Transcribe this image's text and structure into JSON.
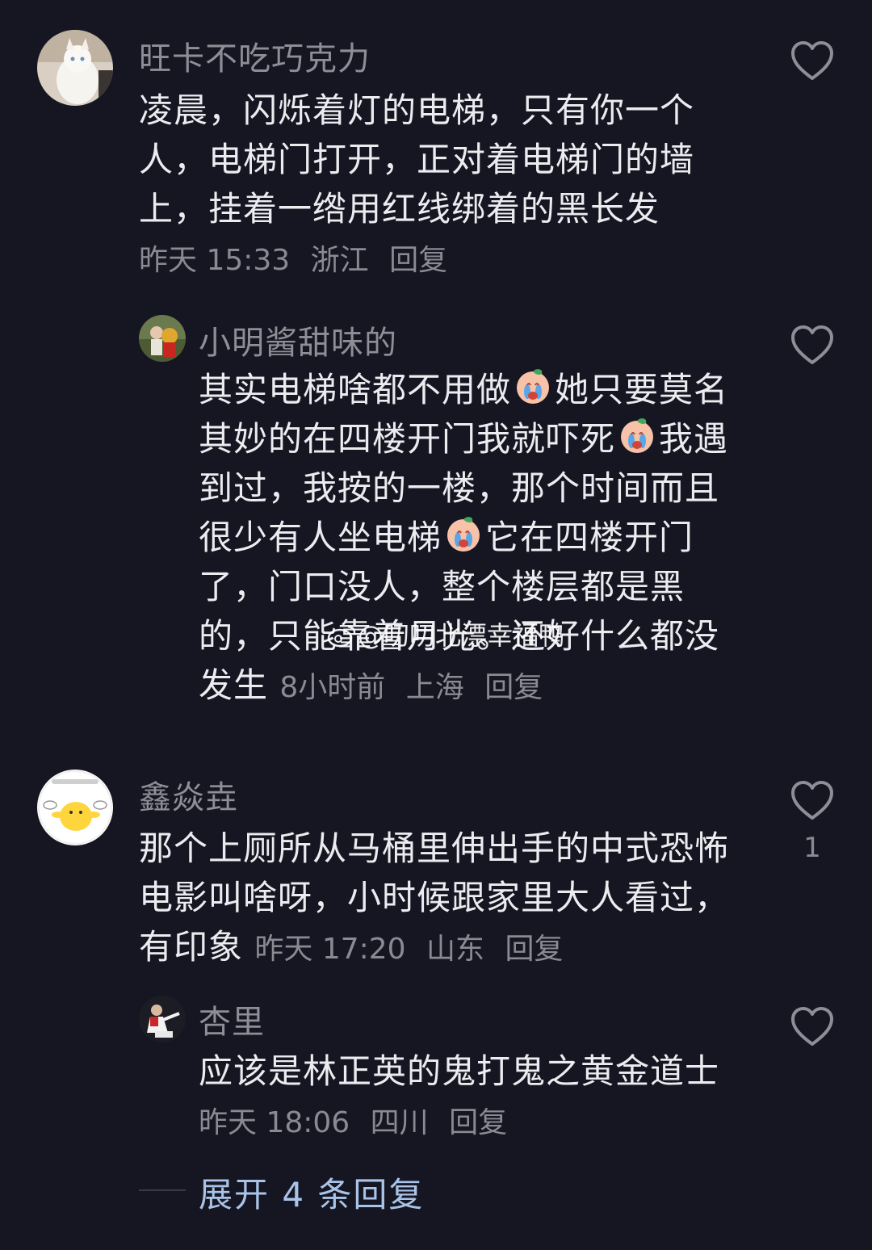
{
  "comments": [
    {
      "username": "旺卡不吃巧克力",
      "text": "凌晨，闪烁着灯的电梯，只有你一个人，电梯门打开，正对着电梯门的墙上，挂着一绺用红线绑着的黑长发",
      "time": "昨天 15:33",
      "location": "浙江",
      "reply": "回复"
    },
    {
      "username": "小明酱甜味的",
      "text_parts": [
        "其实电梯啥都不用做",
        "她只要莫名其妙的在四楼开门我就吓死",
        "我遇到过，我按的一楼，那个时间而且很少有人坐电梯",
        "它在四楼开门了，门口没人，整个楼层都是黑的，只能靠着月光。还好什么都没发生"
      ],
      "time": "8小时前",
      "location": "上海",
      "reply": "回复"
    },
    {
      "username": "鑫焱垚",
      "text": "那个上厕所从马桶里伸出手的中式恐怖电影叫啥呀，小时候跟家里大人看过，有印象",
      "time": "昨天 17:20",
      "location": "山东",
      "reply": "回复",
      "likes": "1"
    },
    {
      "username": "杏里",
      "text": "应该是林正英的鬼打鬼之黄金道士",
      "time": "昨天 18:06",
      "location": "四川",
      "reply": "回复"
    }
  ],
  "expand_label": "展开 4 条回复",
  "watermark": "@叨叨北漂幸福鸭",
  "icons": {
    "like": "heart-outline-icon",
    "emoji": "crying-face-icon",
    "watermark_logo": "weibo-logo-icon"
  },
  "colors": {
    "background": "#161622",
    "text": "#ececf0",
    "secondary": "#8a8a93",
    "link": "#a9c4e8"
  }
}
